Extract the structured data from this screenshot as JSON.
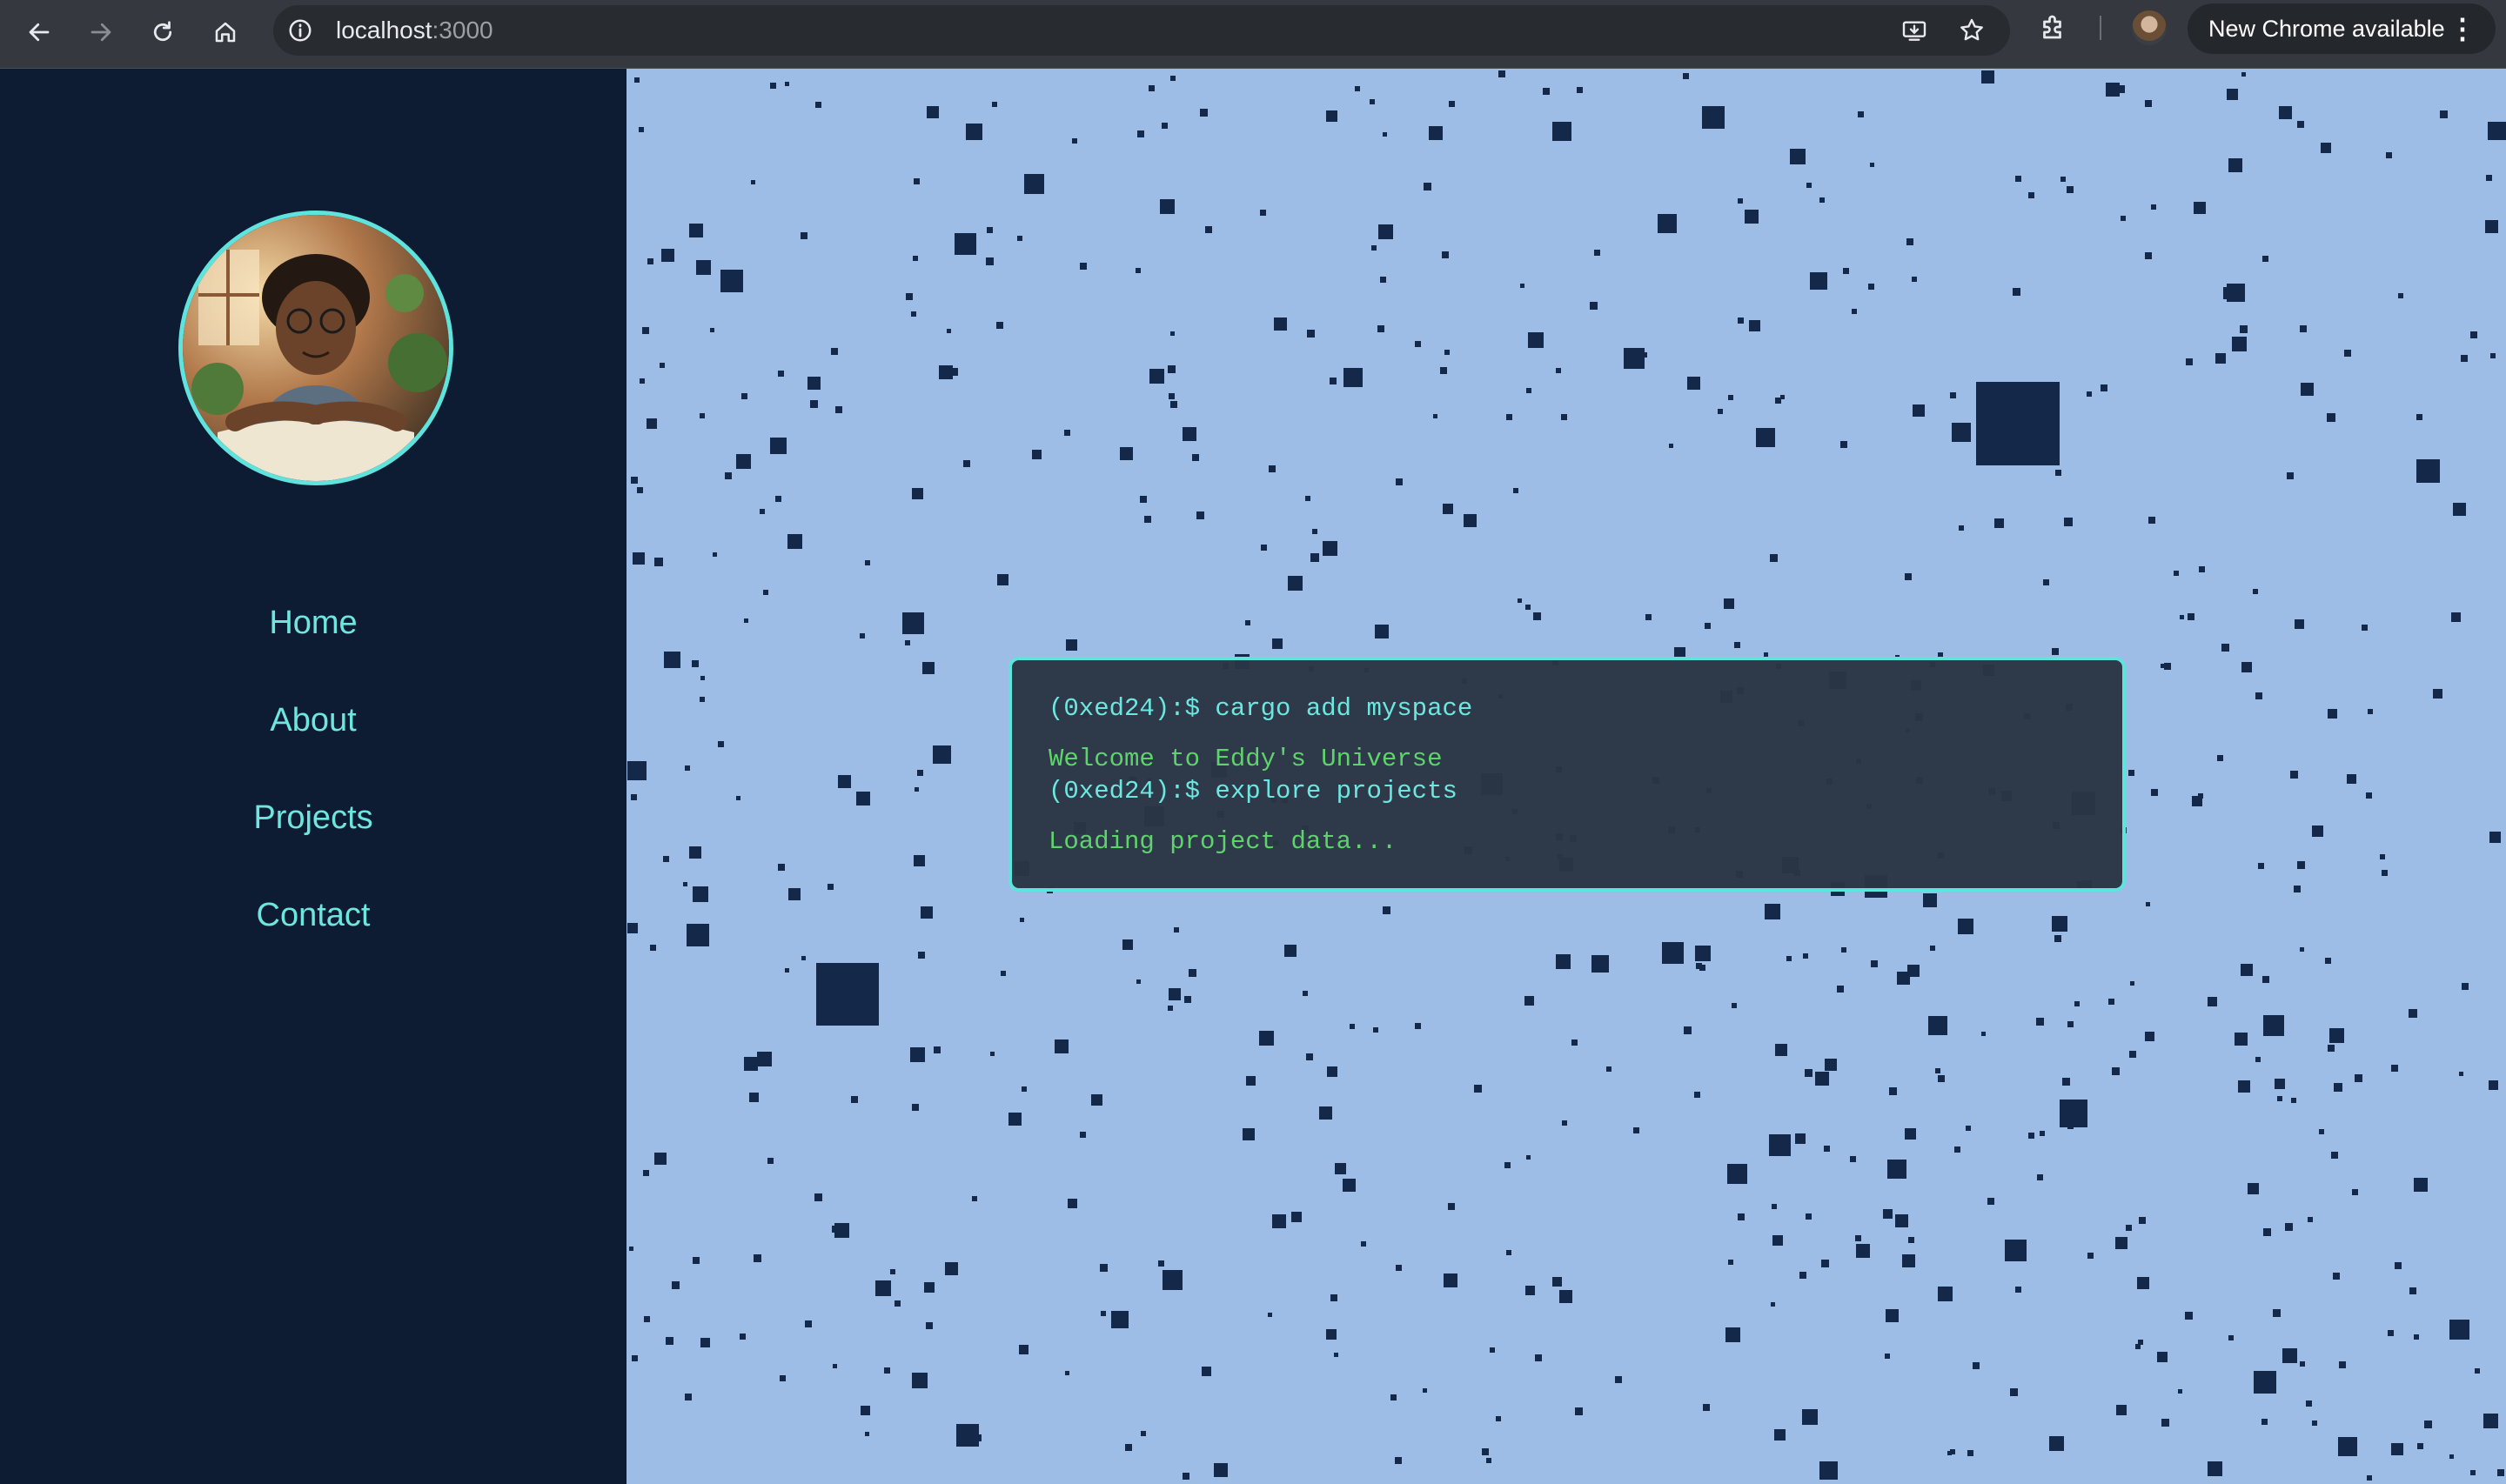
{
  "browser": {
    "url_host": "localhost",
    "url_port": ":3000",
    "update_label": "New Chrome available",
    "icons": [
      "back-arrow-icon",
      "forward-arrow-icon",
      "reload-icon",
      "home-icon",
      "site-info-icon",
      "install-app-icon",
      "bookmark-star-icon",
      "extensions-icon",
      "profile-avatar",
      "menu-kebab-icon"
    ]
  },
  "sidebar": {
    "profile_image": "cartoon portrait avatar",
    "accent_color": "#5fe3dd",
    "background_color": "#0e1c33",
    "nav": [
      {
        "label": "Home"
      },
      {
        "label": "About"
      },
      {
        "label": "Projects"
      },
      {
        "label": "Contact"
      }
    ]
  },
  "terminal": {
    "lines": [
      {
        "text": "(0xed24):$ cargo add myspace",
        "kind": "prompt"
      },
      {
        "text": "Welcome to Eddy's Universe",
        "kind": "output"
      },
      {
        "text": "(0xed24):$ explore projects",
        "kind": "prompt"
      },
      {
        "text": "Loading project data...",
        "kind": "output"
      }
    ]
  },
  "colors": {
    "main_background": "#9dbde6",
    "particle": "#14284a",
    "prompt_text": "#6ee6e0",
    "output_text": "#5ed36b"
  }
}
